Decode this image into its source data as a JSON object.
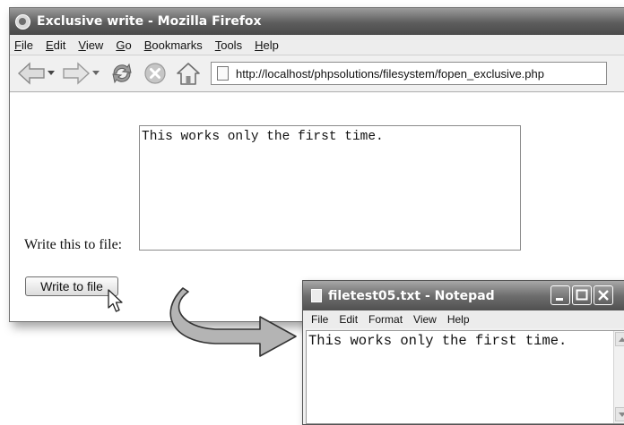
{
  "firefox": {
    "title": "Exclusive write - Mozilla Firefox",
    "menu": [
      "File",
      "Edit",
      "View",
      "Go",
      "Bookmarks",
      "Tools",
      "Help"
    ],
    "toolbar_icons": [
      "back-arrow-icon",
      "dropdown-arrow-icon",
      "forward-arrow-icon",
      "dropdown-arrow-icon",
      "reload-icon",
      "stop-icon",
      "home-icon",
      "page-icon"
    ],
    "url": "http://localhost/phpsolutions/filesystem/fopen_exclusive.php",
    "form": {
      "label": "Write this to file:",
      "textarea_value": "This works only the first time.",
      "button_label": "Write to file"
    }
  },
  "notepad": {
    "title": "filetest05.txt - Notepad",
    "menu": [
      "File",
      "Edit",
      "Format",
      "View",
      "Help"
    ],
    "content": "This works only the first time."
  },
  "colors": {
    "titlebar_dark": "#5d5d5d",
    "arrow_fill": "#b4b4b4"
  }
}
